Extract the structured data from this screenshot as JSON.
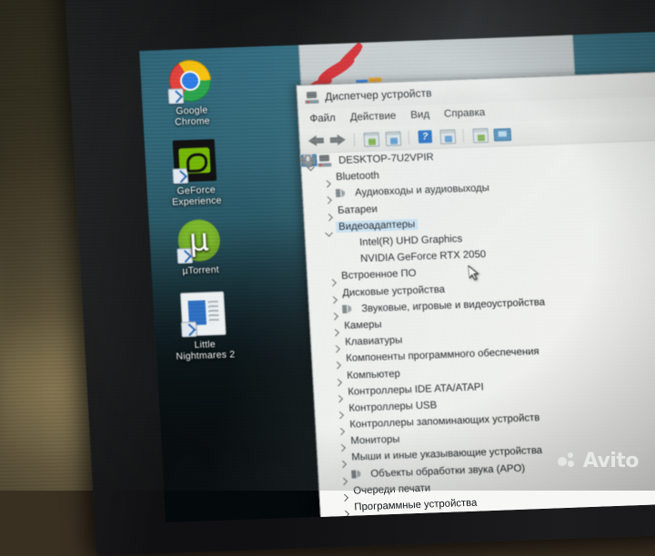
{
  "window": {
    "title": "Диспетчер устройств",
    "title_icon": "computer-icon",
    "menu": [
      "Файл",
      "Действие",
      "Вид",
      "Справка"
    ],
    "toolbar": [
      {
        "name": "back-button",
        "icon": "arrow-left-icon"
      },
      {
        "name": "forward-button",
        "icon": "arrow-right-icon"
      },
      {
        "name": "properties-button",
        "icon": "properties-icon"
      },
      {
        "name": "update-driver-button",
        "icon": "update-driver-icon"
      },
      {
        "name": "help-button",
        "icon": "help-question-icon",
        "label": "?"
      },
      {
        "name": "scan-hardware-button",
        "icon": "scan-hardware-icon"
      },
      {
        "name": "uninstall-device-button",
        "icon": "uninstall-device-icon"
      },
      {
        "name": "show-devices-button",
        "icon": "monitor-icon"
      }
    ]
  },
  "tree": {
    "root": {
      "label": "DESKTOP-7U2VPIR",
      "icon": "computer-icon",
      "expanded": true
    },
    "nodes": [
      {
        "label": "Bluetooth",
        "icon": "bluetooth-icon",
        "level": 1,
        "expanded": false,
        "selected": false
      },
      {
        "label": "Аудиовходы и аудиовыходы",
        "icon": "speaker-icon",
        "level": 1,
        "expanded": false,
        "selected": false
      },
      {
        "label": "Батареи",
        "icon": "battery-icon",
        "level": 1,
        "expanded": false,
        "selected": false
      },
      {
        "label": "Видеоадаптеры",
        "icon": "display-adapter-icon",
        "level": 1,
        "expanded": true,
        "selected": true
      },
      {
        "label": "Intel(R) UHD Graphics",
        "icon": "display-adapter-icon",
        "level": 2,
        "expanded": null,
        "selected": false
      },
      {
        "label": "NVIDIA GeForce RTX 2050",
        "icon": "display-adapter-icon",
        "level": 2,
        "expanded": null,
        "selected": false
      },
      {
        "label": "Встроенное ПО",
        "icon": "firmware-icon",
        "level": 1,
        "expanded": false,
        "selected": false
      },
      {
        "label": "Дисковые устройства",
        "icon": "disk-drive-icon",
        "level": 1,
        "expanded": false,
        "selected": false
      },
      {
        "label": "Звуковые, игровые и видеоустройства",
        "icon": "speaker-icon",
        "level": 1,
        "expanded": false,
        "selected": false
      },
      {
        "label": "Камеры",
        "icon": "camera-icon",
        "level": 1,
        "expanded": false,
        "selected": false
      },
      {
        "label": "Клавиатуры",
        "icon": "keyboard-icon",
        "level": 1,
        "expanded": false,
        "selected": false
      },
      {
        "label": "Компоненты программного обеспечения",
        "icon": "software-component-icon",
        "level": 1,
        "expanded": false,
        "selected": false
      },
      {
        "label": "Компьютер",
        "icon": "display-adapter-icon",
        "level": 1,
        "expanded": false,
        "selected": false
      },
      {
        "label": "Контроллеры IDE ATA/ATAPI",
        "icon": "ide-controller-icon",
        "level": 1,
        "expanded": false,
        "selected": false
      },
      {
        "label": "Контроллеры USB",
        "icon": "usb-icon",
        "level": 1,
        "expanded": false,
        "selected": false
      },
      {
        "label": "Контроллеры запоминающих устройств",
        "icon": "storage-controller-icon",
        "level": 1,
        "expanded": false,
        "selected": false
      },
      {
        "label": "Мониторы",
        "icon": "display-adapter-icon",
        "level": 1,
        "expanded": false,
        "selected": false
      },
      {
        "label": "Мыши и иные указывающие устройства",
        "icon": "mouse-icon",
        "level": 1,
        "expanded": false,
        "selected": false
      },
      {
        "label": "Объекты обработки звука (APO)",
        "icon": "audio-processing-icon",
        "level": 1,
        "expanded": false,
        "selected": false
      },
      {
        "label": "Очереди печати",
        "icon": "printer-icon",
        "level": 1,
        "expanded": false,
        "selected": false
      },
      {
        "label": "Программные устройства",
        "icon": "software-device-icon",
        "level": 1,
        "expanded": false,
        "selected": false
      }
    ]
  },
  "desktop": {
    "icons": [
      {
        "label_line1": "Google",
        "label_line2": "Chrome",
        "icon": "chrome-icon",
        "shortcut": true
      },
      {
        "label_line1": "GeForce",
        "label_line2": "Experience",
        "icon": "nvidia-icon",
        "shortcut": true
      },
      {
        "label_line1": "µTorrent",
        "label_line2": "",
        "icon": "utorrent-icon",
        "shortcut": true
      },
      {
        "label_line1": "Little",
        "label_line2": "Nightmares 2",
        "icon": "generic-app-icon",
        "shortcut": true
      }
    ]
  },
  "watermark": {
    "text": "Avito",
    "logo": "avito-dots-logo"
  },
  "colors": {
    "selection": "#cfe8fb",
    "window_bg": "#f1f1ef",
    "accent_blue": "#1668c8",
    "nvidia_green": "#76b900",
    "utorrent_green": "#7cb928"
  }
}
